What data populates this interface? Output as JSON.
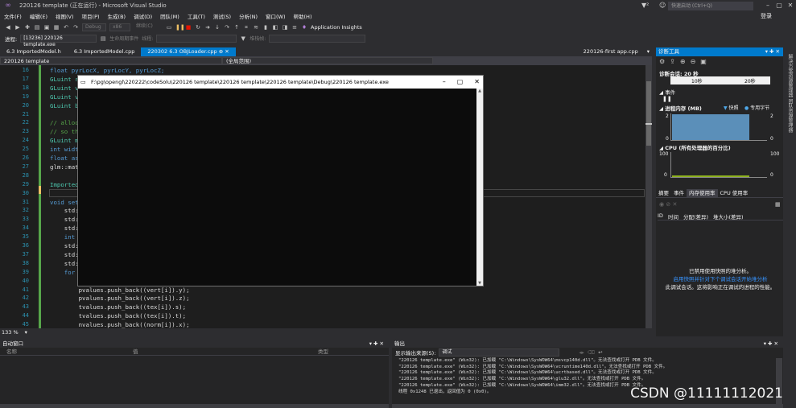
{
  "window": {
    "title": "220126 template (正在运行) - Microsoft Visual Studio",
    "quick_launch": "快速启动 (Ctrl+Q)",
    "signin": "登录"
  },
  "menu": [
    "文件(F)",
    "编辑(E)",
    "视图(V)",
    "项目(P)",
    "生成(B)",
    "调试(D)",
    "团队(M)",
    "工具(T)",
    "测试(S)",
    "分析(N)",
    "窗口(W)",
    "帮助(H)"
  ],
  "toolbar": {
    "config": "Debug",
    "platform": "x86",
    "continue": "继续(C)",
    "insights": "Application Insights"
  },
  "toolbar2": {
    "process_label": "进程:",
    "process": "[13236] 220126 template.exe",
    "lifecycle": "生命周期事件",
    "thread": "线程:",
    "stack": "堆栈帧:"
  },
  "tabs": [
    "6.3 ImportedModel.h",
    "6.3 ImportedModel.cpp",
    "220302 6.3 OBJLoader.cpp",
    "220126-first app.cpp"
  ],
  "nav": {
    "project": "220126 template",
    "scope": "(全局范围)"
  },
  "editor": {
    "zoom": "133 %",
    "lines": [
      {
        "n": "16",
        "t": "float pyrLocX, pyrLocY, pyrLocZ;"
      },
      {
        "n": "17",
        "t": "GLuint r"
      },
      {
        "n": "18",
        "t": "GLuint v"
      },
      {
        "n": "19",
        "t": "GLuint v"
      },
      {
        "n": "20",
        "t": "GLuint b"
      },
      {
        "n": "21",
        "t": ""
      },
      {
        "n": "22",
        "t": "// alloc"
      },
      {
        "n": "23",
        "t": "// so th"
      },
      {
        "n": "24",
        "t": "GLuint m"
      },
      {
        "n": "25",
        "t": "int widt"
      },
      {
        "n": "26",
        "t": "float as"
      },
      {
        "n": "27",
        "t": "glm::mat"
      },
      {
        "n": "28",
        "t": ""
      },
      {
        "n": "29",
        "t": "Imported"
      },
      {
        "n": "30",
        "t": ""
      },
      {
        "n": "31",
        "t": "void set"
      },
      {
        "n": "32",
        "t": "    std:"
      },
      {
        "n": "33",
        "t": "    std:"
      },
      {
        "n": "34",
        "t": "    std:"
      },
      {
        "n": "35",
        "t": "    int"
      },
      {
        "n": "36",
        "t": "    std:"
      },
      {
        "n": "37",
        "t": "    std:"
      },
      {
        "n": "38",
        "t": "    std:"
      },
      {
        "n": "39",
        "t": "    for"
      },
      {
        "n": "40",
        "t": ""
      },
      {
        "n": "41",
        "t": "        pvalues.push_back((vert[i]).y);"
      },
      {
        "n": "42",
        "t": "        pvalues.push_back((vert[i]).z);"
      },
      {
        "n": "43",
        "t": "        tvalues.push_back((tex[i]).s);"
      },
      {
        "n": "44",
        "t": "        tvalues.push_back((tex[i]).t);"
      },
      {
        "n": "45",
        "t": "        nvalues.push_back((norm[i]).x);"
      }
    ]
  },
  "diag": {
    "title": "诊断工具",
    "session": "诊断会话: 20 秒",
    "t10": "10秒",
    "t20": "20秒",
    "events": "事件",
    "memory": "进程内存 (MB)",
    "snapshot": "快照",
    "private": "专用字节",
    "mem_max": "2",
    "mem_min": "0",
    "cpu": "CPU (所有处理器的百分比)",
    "cpu_max": "100",
    "cpu_min": "0",
    "tabs": [
      "摘要",
      "事件",
      "内存使用率",
      "CPU 使用率"
    ],
    "cols": [
      "ID",
      "时间",
      "分配(差异)",
      "堆大小(差异)"
    ],
    "msg1": "已禁用使用快照的堆分析。",
    "msg2": "启用快照并针对下个调试会话开始堆分析",
    "msg3": "此调试会话。这将影响正在调试的进程的性能。",
    "cpu_usage_pct": 0.05
  },
  "autos": {
    "title": "自动窗口",
    "cols": [
      "名称",
      "值",
      "类型"
    ]
  },
  "output": {
    "title": "输出",
    "source_label": "显示输出来源(S):",
    "source": "调试",
    "lines": [
      "\"220126 template.exe\" (Win32): 已加载 \"C:\\Windows\\SysWOW64\\msvcp140d.dll\"。无法查找或打开 PDB 文件。",
      "\"220126 template.exe\" (Win32): 已加载 \"C:\\Windows\\SysWOW64\\vcruntime140d.dll\"。无法查找或打开 PDB 文件。",
      "\"220126 template.exe\" (Win32): 已加载 \"C:\\Windows\\SysWOW64\\ucrtbased.dll\"。无法查找或打开 PDB 文件。",
      "\"220126 template.exe\" (Win32): 已加载 \"C:\\Windows\\SysWOW64\\glu32.dll\"。无法查找或打开 PDB 文件。",
      "\"220126 template.exe\" (Win32): 已加载 \"C:\\Windows\\SysWOW64\\imm32.dll\"。无法查找或打开 PDB 文件。",
      "线程 0x1248 已退出，返回值为 0 (0x0)。"
    ]
  },
  "console": {
    "title": "F:\\pg\\opengl\\220222\\codeSolu\\220126 template\\220126 template\\220126 template\\Debug\\220126 template.exe"
  },
  "watermark": "CSDN @11111112021"
}
